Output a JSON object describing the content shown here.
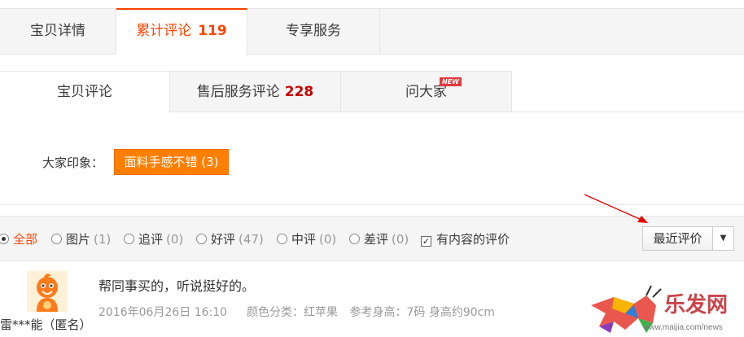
{
  "top_tabs": [
    {
      "label": "宝贝详情",
      "count": ""
    },
    {
      "label": "累计评论",
      "count": "119"
    },
    {
      "label": "专享服务",
      "count": ""
    }
  ],
  "sub_tabs": [
    {
      "label": "宝贝评论",
      "count": ""
    },
    {
      "label": "售后服务评论",
      "count": "228"
    },
    {
      "label": "问大家",
      "count": "",
      "badge": "NEW"
    }
  ],
  "impression": {
    "label": "大家印象：",
    "tag": "面料手感不错 (3)"
  },
  "filters": [
    {
      "label": "全部",
      "count": "",
      "selected": true
    },
    {
      "label": "图片",
      "count": "(1)",
      "selected": false
    },
    {
      "label": "追评",
      "count": "(0)",
      "selected": false
    },
    {
      "label": "好评",
      "count": "(47)",
      "selected": false
    },
    {
      "label": "中评",
      "count": "(0)",
      "selected": false
    },
    {
      "label": "差评",
      "count": "(0)",
      "selected": false
    }
  ],
  "content_checkbox": {
    "label": "有内容的评价",
    "checked": true
  },
  "sort": {
    "value": "最近评价"
  },
  "review": {
    "reviewer": "雷***能（匿名）",
    "text": "帮同事买的，听说挺好的。",
    "date": "2016年06月26日 16:10",
    "color": "颜色分类：红苹果",
    "height": "参考身高：7码 身高约90cm"
  },
  "watermark": {
    "logo_text": "乐发网",
    "url": "www.maijia.com/news"
  },
  "colors": {
    "accent": "#ff4400",
    "count_red": "#c40000",
    "tag_orange": "#ff7f00",
    "arrow_red": "#e60000"
  },
  "icons": [
    "radio-icon",
    "checkbox-icon",
    "chevron-down-icon",
    "red-arrow-annotation"
  ]
}
